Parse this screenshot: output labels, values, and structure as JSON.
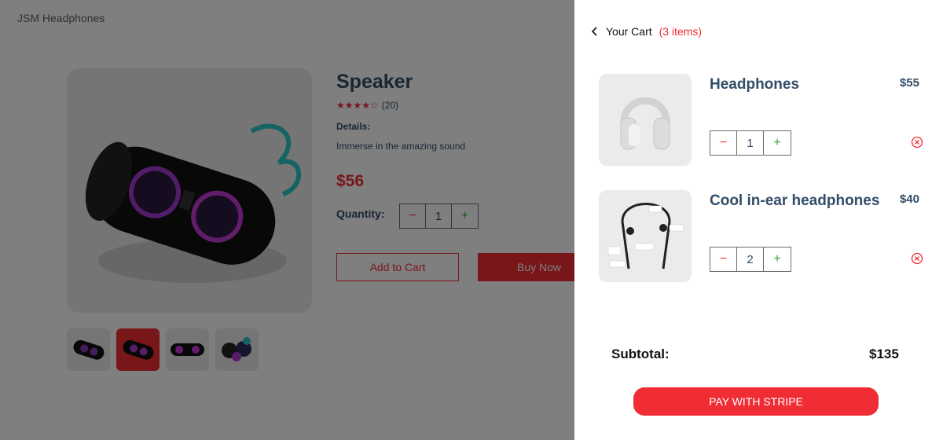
{
  "header": {
    "logo": "JSM Headphones"
  },
  "product": {
    "name": "Speaker",
    "stars": "★★★★☆",
    "review_count": "(20)",
    "details_heading": "Details:",
    "details_text": "Immerse in the amazing sound",
    "price": "$56",
    "quantity_label": "Quantity:",
    "quantity": {
      "minus": "−",
      "value": "1",
      "plus": "+"
    },
    "add_to_cart_label": "Add to Cart",
    "buy_now_label": "Buy Now",
    "thumbnails": [
      {
        "icon": "speaker-thumbnail",
        "selected": false
      },
      {
        "icon": "speaker-thumbnail",
        "selected": true
      },
      {
        "icon": "speaker-thumbnail",
        "selected": false
      },
      {
        "icon": "speaker-thumbnail",
        "selected": false
      }
    ]
  },
  "cart": {
    "back_icon": "chevron-left-icon",
    "title": "Your Cart",
    "count": "(3 items)",
    "items": [
      {
        "name": "Headphones",
        "price": "$55",
        "quantity": "1",
        "minus": "−",
        "plus": "+",
        "icon": "headphones-image"
      },
      {
        "name": "Cool in-ear headphones",
        "price": "$40",
        "quantity": "2",
        "minus": "−",
        "plus": "+",
        "icon": "earphones-image"
      }
    ],
    "subtotal_label": "Subtotal:",
    "subtotal_value": "$135",
    "pay_label": "PAY WITH STRIPE"
  },
  "colors": {
    "accent": "#f02d34",
    "text": "#324d67",
    "plus": "#31a831",
    "image_bg": "#ebebeb"
  }
}
